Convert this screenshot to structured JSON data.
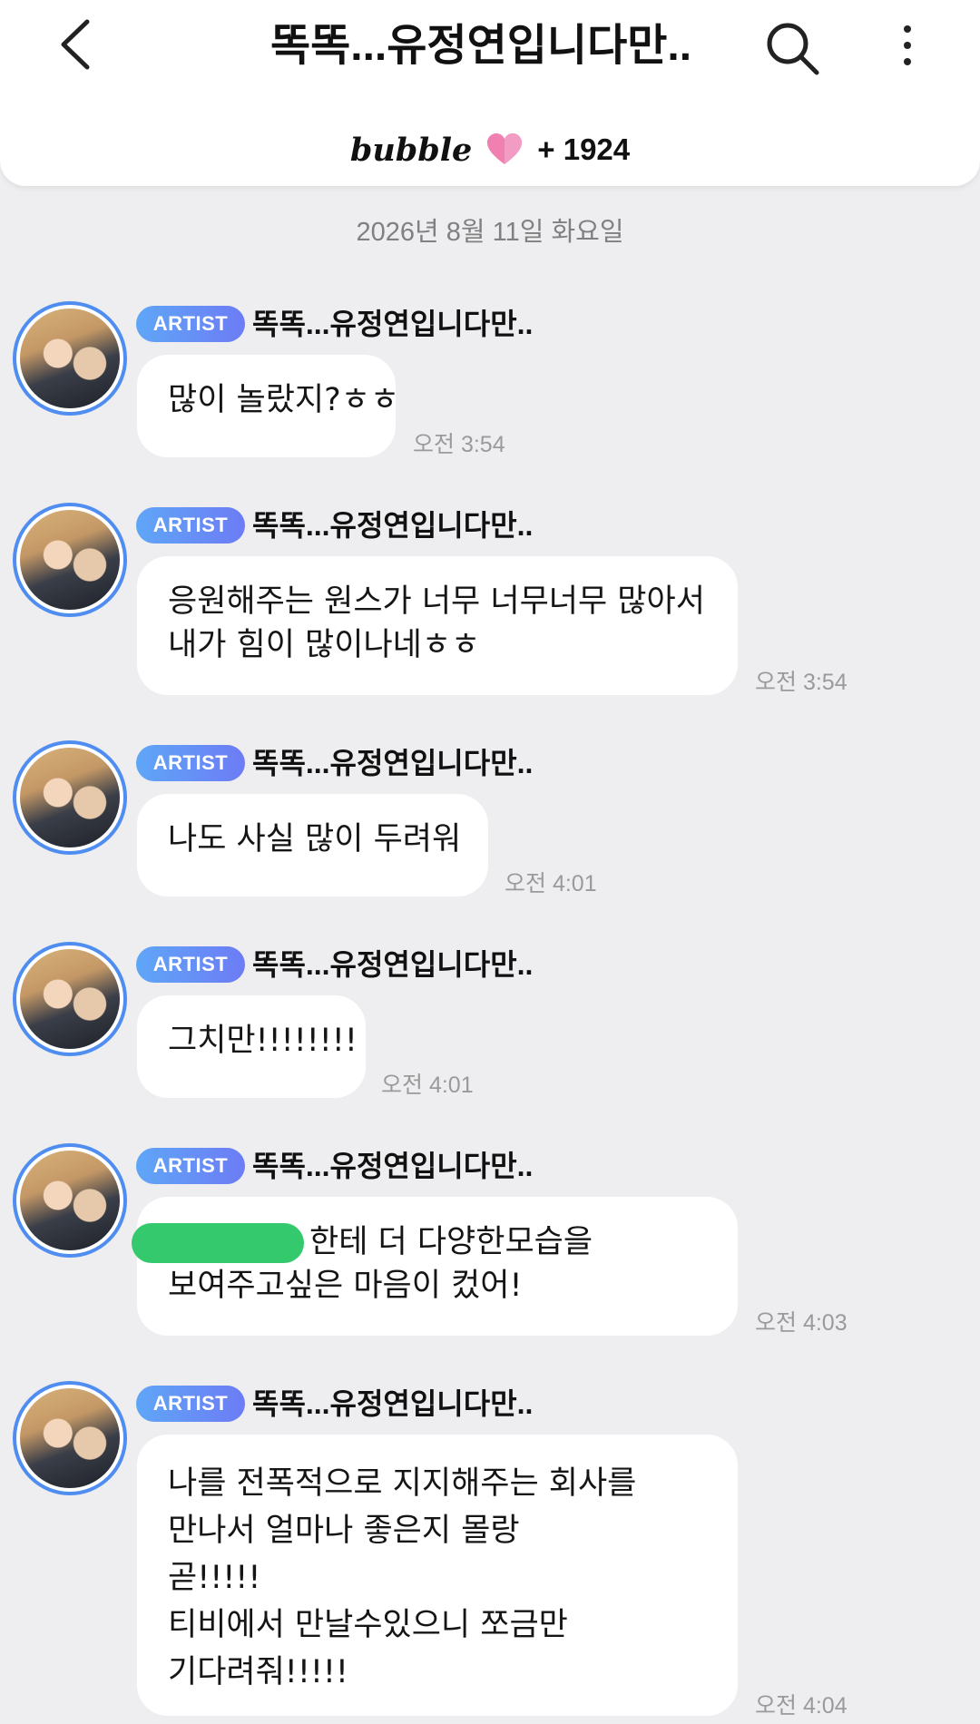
{
  "header": {
    "title": "똑똑...유정연입니다만..",
    "bubble_logo": "bubble",
    "count": "+ 1924"
  },
  "icons": {
    "back": "chevron-left-icon",
    "search": "search-icon",
    "more": "more-vertical-icon",
    "heart": "heart-icon"
  },
  "colors": {
    "badge_start": "#5fa6f7",
    "badge_end": "#6d7cf5",
    "heart": "#f080b0",
    "censor": "#35c96e",
    "background": "#eeeef0"
  },
  "date_separator": "2026년 8월 11일 화요일",
  "messages": [
    {
      "badge": "ARTIST",
      "sender": "똑똑...유정연입니다만..",
      "lines": [
        "많이 놀랐지?ㅎㅎ"
      ],
      "time": "오전 3:54"
    },
    {
      "badge": "ARTIST",
      "sender": "똑똑...유정연입니다만..",
      "lines": [
        "응원해주는 원스가 너무 너무너무 많아서",
        "내가 힘이 많이나네ㅎㅎ"
      ],
      "time": "오전 3:54"
    },
    {
      "badge": "ARTIST",
      "sender": "똑똑...유정연입니다만..",
      "lines": [
        "나도 사실 많이 두려워"
      ],
      "time": "오전 4:01"
    },
    {
      "badge": "ARTIST",
      "sender": "똑똑...유정연입니다만..",
      "lines": [
        "그치만!!!!!!!!"
      ],
      "time": "오전 4:01"
    },
    {
      "badge": "ARTIST",
      "sender": "똑똑...유정연입니다만..",
      "lines": [
        "한테 더 다양한모습을",
        "보여주고싶은 마음이 컸어!"
      ],
      "time": "오전 4:03"
    },
    {
      "badge": "ARTIST",
      "sender": "똑똑...유정연입니다만..",
      "lines": [
        "나를 전폭적으로 지지해주는 회사를",
        "만나서 얼마나 좋은지 몰랑",
        "곧!!!!!",
        "티비에서 만날수있으니 쪼금만",
        "기다려줘!!!!!"
      ],
      "time": "오전 4:04"
    }
  ]
}
